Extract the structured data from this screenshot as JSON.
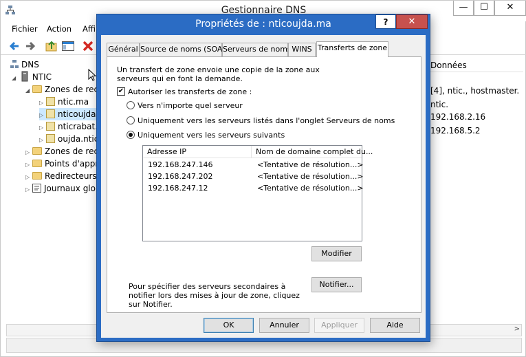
{
  "main": {
    "title": "Gestionnaire DNS",
    "menu": [
      "Fichier",
      "Action",
      "Affi"
    ],
    "controls": {
      "minimize": "—",
      "maximize": "☐",
      "close": "✕"
    },
    "tree": {
      "root": "DNS",
      "server": "NTIC",
      "folder_forward": "Zones de rech",
      "zones": [
        "ntic.ma",
        "nticoujda",
        "nticrabat.",
        "oujda.ntic"
      ],
      "folder_reverse": "Zones de rech",
      "points": "Points d'appr",
      "redirectors": "Redirecteurs",
      "logs": "Journaux glob"
    },
    "right_pane": {
      "column_header": "Données",
      "values": [
        "[4], ntic., hostmaster.",
        "ntic.",
        "192.168.2.16",
        "192.168.5.2"
      ]
    }
  },
  "dialog": {
    "title": "Propriétés de : nticoujda.ma",
    "help": "?",
    "close": "✕",
    "tabs": [
      "Général",
      "Source de noms (SOA)",
      "Serveurs de noms",
      "WINS",
      "Transferts de zone"
    ],
    "active_tab": "Transferts de zone",
    "description": "Un transfert de zone envoie une copie de la zone aux serveurs qui en font la demande.",
    "allow_transfers": {
      "label": "Autoriser les transferts de zone :",
      "checked": true
    },
    "options": [
      {
        "label": "Vers n'importe quel serveur",
        "selected": false
      },
      {
        "label": "Uniquement vers les serveurs listés dans l'onglet Serveurs de noms",
        "selected": false
      },
      {
        "label": "Uniquement vers les serveurs suivants",
        "selected": true
      }
    ],
    "list": {
      "columns": [
        "Adresse IP",
        "Nom de domaine complet du..."
      ],
      "rows": [
        {
          "ip": "192.168.247.146",
          "fqdn": "<Tentative de résolution...>"
        },
        {
          "ip": "192.168.247.202",
          "fqdn": "<Tentative de résolution...>"
        },
        {
          "ip": "192.168.247.12",
          "fqdn": "<Tentative de résolution...>"
        }
      ]
    },
    "modify_button": "Modifier",
    "notify_text": "Pour spécifier des serveurs secondaires à notifier lors des mises à jour de zone, cliquez sur Notifier.",
    "notify_button": "Notifier...",
    "buttons": {
      "ok": "OK",
      "cancel": "Annuler",
      "apply": "Appliquer",
      "help": "Aide"
    }
  }
}
